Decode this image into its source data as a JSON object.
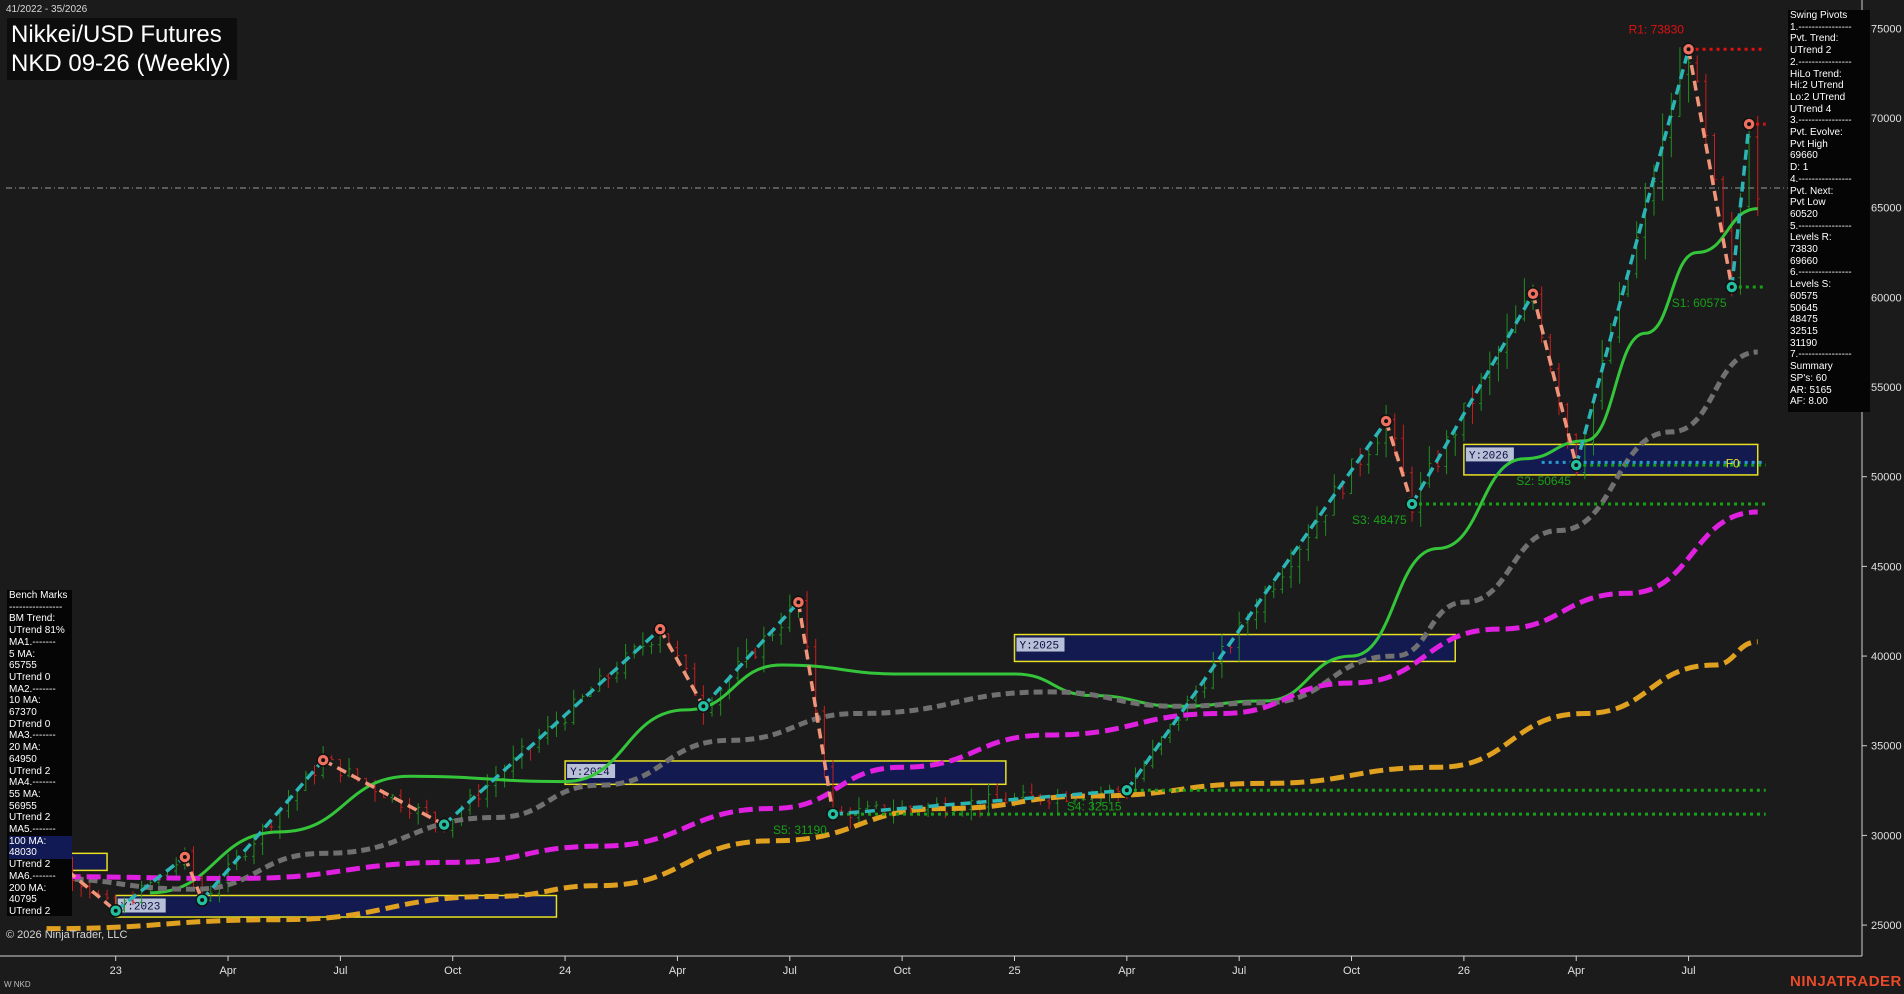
{
  "header": {
    "date_range": "41/2022 - 35/2026",
    "title_line1": "Nikkei/USD Futures",
    "title_line2": "NKD 09-26 (Weekly)"
  },
  "swing_pivots_panel": [
    "Swing Pivots",
    "1.----------------",
    "Pvt. Trend:",
    "UTrend 2",
    "2.----------------",
    "HiLo Trend:",
    "Hi:2 UTrend",
    "Lo:2 UTrend",
    "UTrend 4",
    "3.----------------",
    "Pvt. Evolve:",
    "Pvt High",
    "69660",
    "D: 1",
    "4.----------------",
    "Pvt. Next:",
    "Pvt Low",
    "60520",
    "5.----------------",
    "Levels R:",
    "73830",
    "69660",
    "6.----------------",
    "Levels S:",
    "60575",
    "50645",
    "48475",
    "32515",
    "31190",
    "7.----------------",
    "Summary",
    "SP's: 60",
    "AR: 5165",
    "AF: 8.00"
  ],
  "bench_marks_panel": [
    "Bench Marks",
    "----------------",
    "BM Trend:",
    "UTrend 81%",
    "MA1.-------",
    "5 MA:",
    "65755",
    "UTrend 0",
    "MA2.-------",
    "10 MA:",
    "67370",
    "DTrend 0",
    "MA3.-------",
    "20 MA:",
    "64950",
    "UTrend 2",
    "MA4.-------",
    "55 MA:",
    "56955",
    "UTrend 2",
    "MA5.-------",
    "100 MA:",
    "48030",
    "UTrend 2",
    "MA6.-------",
    "200 MA:",
    "40795",
    "UTrend 2"
  ],
  "footer": {
    "copyright": "© 2026 NinjaTrader, LLC",
    "instrument": "W NKD",
    "brand": "NINJATRADER"
  },
  "colors": {
    "background": "#1b1b1b",
    "up_bar": "#1f8f1f",
    "down_bar": "#c81e1e",
    "swing_up": "#2bb5b5",
    "swing_down": "#f0957a",
    "ma20": "#35c53a",
    "ma55": "#707070",
    "ma100": "#e020e0",
    "ma200": "#e0a020",
    "resistance": "#e01010",
    "support": "#18a018",
    "year_box": "#111a55",
    "year_border": "#e8e020"
  },
  "chart_data": {
    "type": "candlestick",
    "y_axis": {
      "min": 23500,
      "max": 76300,
      "ticks": [
        25000,
        30000,
        35000,
        40000,
        45000,
        50000,
        55000,
        60000,
        65000,
        70000,
        75000
      ],
      "position": "right"
    },
    "x_axis": {
      "start": "2022-W41",
      "end": "2026-W35",
      "ticks": [
        {
          "label": "23",
          "date": "2023-01"
        },
        {
          "label": "Apr",
          "date": "2023-04"
        },
        {
          "label": "Jul",
          "date": "2023-07"
        },
        {
          "label": "Oct",
          "date": "2023-10"
        },
        {
          "label": "24",
          "date": "2024-01"
        },
        {
          "label": "Apr",
          "date": "2024-04"
        },
        {
          "label": "Jul",
          "date": "2024-07"
        },
        {
          "label": "Oct",
          "date": "2024-10"
        },
        {
          "label": "25",
          "date": "2025-01"
        },
        {
          "label": "Apr",
          "date": "2025-04"
        },
        {
          "label": "Jul",
          "date": "2025-07"
        },
        {
          "label": "Oct",
          "date": "2025-10"
        },
        {
          "label": "26",
          "date": "2026-01"
        },
        {
          "label": "Apr",
          "date": "2026-04"
        },
        {
          "label": "Jul",
          "date": "2026-07"
        }
      ]
    },
    "last_price_line": 66100,
    "swing_pivots": [
      {
        "date": "2022-W46",
        "value": 28600,
        "kind": "high"
      },
      {
        "date": "2023-W01",
        "value": 25800,
        "kind": "low"
      },
      {
        "date": "2023-W09",
        "value": 28800,
        "kind": "high"
      },
      {
        "date": "2023-W11",
        "value": 26400,
        "kind": "low"
      },
      {
        "date": "2023-W25",
        "value": 34200,
        "kind": "high"
      },
      {
        "date": "2023-W39",
        "value": 30600,
        "kind": "low"
      },
      {
        "date": "2024-W12",
        "value": 41500,
        "kind": "high"
      },
      {
        "date": "2024-W17",
        "value": 37200,
        "kind": "low"
      },
      {
        "date": "2024-W28",
        "value": 43000,
        "kind": "high"
      },
      {
        "date": "2024-W32",
        "value": 31190,
        "kind": "low"
      },
      {
        "date": "2025-W14",
        "value": 32515,
        "kind": "low"
      },
      {
        "date": "2025-W44",
        "value": 53100,
        "kind": "high"
      },
      {
        "date": "2025-W47",
        "value": 48475,
        "kind": "low"
      },
      {
        "date": "2026-W09",
        "value": 60200,
        "kind": "high"
      },
      {
        "date": "2026-W14",
        "value": 50645,
        "kind": "low"
      },
      {
        "date": "2026-W27",
        "value": 73830,
        "kind": "high"
      },
      {
        "date": "2026-W32",
        "value": 60575,
        "kind": "low"
      },
      {
        "date": "2026-W34",
        "value": 69660,
        "kind": "high"
      }
    ],
    "levels": [
      {
        "label": "R1: 73830",
        "value": 73830,
        "type": "resistance"
      },
      {
        "label": "",
        "value": 69660,
        "type": "resistance"
      },
      {
        "label": "S1: 60575",
        "value": 60575,
        "type": "support"
      },
      {
        "label": "S2: 50645",
        "value": 50645,
        "type": "support"
      },
      {
        "label": "S3: 48475",
        "value": 48475,
        "type": "support"
      },
      {
        "label": "S4: 32515",
        "value": 32515,
        "type": "support"
      },
      {
        "label": "S5: 31190",
        "value": 31190,
        "type": "support"
      },
      {
        "label": "F0",
        "value": 50800,
        "type": "fib"
      }
    ],
    "year_boxes": [
      {
        "label": "Y:2023",
        "date_start": "2023-W01",
        "date_end": "2023-W52",
        "low": 25450,
        "high": 26650
      },
      {
        "label": "Y:2024",
        "date_start": "2024-W01",
        "date_end": "2024-W52",
        "low": 32850,
        "high": 34150
      },
      {
        "label": "Y:2025",
        "date_start": "2025-W01",
        "date_end": "2025-W52",
        "low": 39700,
        "high": 41200
      },
      {
        "label": "Y:2026",
        "date_start": "2026-W01",
        "date_end": "2026-W35",
        "low": 50100,
        "high": 51800
      },
      {
        "label": "",
        "date_start": "2022-W41",
        "date_end": "2022-W52",
        "low": 28050,
        "high": 29000
      }
    ],
    "moving_averages": [
      {
        "name": "20 MA",
        "style": "solid",
        "color": "#35c53a",
        "points": [
          [
            "2023-W05",
            26800
          ],
          [
            "2023-W20",
            30200
          ],
          [
            "2023-W35",
            33300
          ],
          [
            "2024-W01",
            33000
          ],
          [
            "2024-W15",
            37000
          ],
          [
            "2024-W26",
            39500
          ],
          [
            "2024-W40",
            39000
          ],
          [
            "2025-W01",
            39000
          ],
          [
            "2025-W10",
            37800
          ],
          [
            "2025-W20",
            37200
          ],
          [
            "2025-W30",
            37500
          ],
          [
            "2025-W40",
            40000
          ],
          [
            "2025-W50",
            46000
          ],
          [
            "2026-W08",
            51000
          ],
          [
            "2026-W15",
            52000
          ],
          [
            "2026-W22",
            58000
          ],
          [
            "2026-W28",
            62500
          ],
          [
            "2026-W35",
            64950
          ]
        ]
      },
      {
        "name": "55 MA",
        "style": "dashed",
        "color": "#707070",
        "points": [
          [
            "2022-W45",
            27600
          ],
          [
            "2023-W10",
            27000
          ],
          [
            "2023-W25",
            29000
          ],
          [
            "2023-W45",
            31000
          ],
          [
            "2024-W05",
            32800
          ],
          [
            "2024-W20",
            35300
          ],
          [
            "2024-W35",
            36800
          ],
          [
            "2025-W05",
            38000
          ],
          [
            "2025-W20",
            37200
          ],
          [
            "2025-W30",
            37400
          ],
          [
            "2025-W45",
            40000
          ],
          [
            "2026-W01",
            43000
          ],
          [
            "2026-W12",
            47000
          ],
          [
            "2026-W25",
            52500
          ],
          [
            "2026-W35",
            56955
          ]
        ]
      },
      {
        "name": "100 MA",
        "style": "dashed",
        "color": "#e020e0",
        "points": [
          [
            "2022-W45",
            27700
          ],
          [
            "2023-W15",
            27600
          ],
          [
            "2023-W40",
            28500
          ],
          [
            "2024-W05",
            29400
          ],
          [
            "2024-W25",
            31500
          ],
          [
            "2024-W40",
            33800
          ],
          [
            "2025-W05",
            35600
          ],
          [
            "2025-W25",
            36800
          ],
          [
            "2025-W40",
            38500
          ],
          [
            "2026-W05",
            41500
          ],
          [
            "2026-W20",
            43500
          ],
          [
            "2026-W35",
            48030
          ]
        ]
      },
      {
        "name": "200 MA",
        "style": "dashed",
        "color": "#e0a020",
        "points": [
          [
            "2022-W45",
            24800
          ],
          [
            "2023-W20",
            25300
          ],
          [
            "2023-W45",
            26600
          ],
          [
            "2024-W05",
            27200
          ],
          [
            "2024-W25",
            29700
          ],
          [
            "2024-W45",
            31500
          ],
          [
            "2025-W10",
            32200
          ],
          [
            "2025-W30",
            32900
          ],
          [
            "2025-W50",
            33800
          ],
          [
            "2026-W15",
            36800
          ],
          [
            "2026-W30",
            39500
          ],
          [
            "2026-W35",
            40795
          ]
        ]
      }
    ]
  }
}
